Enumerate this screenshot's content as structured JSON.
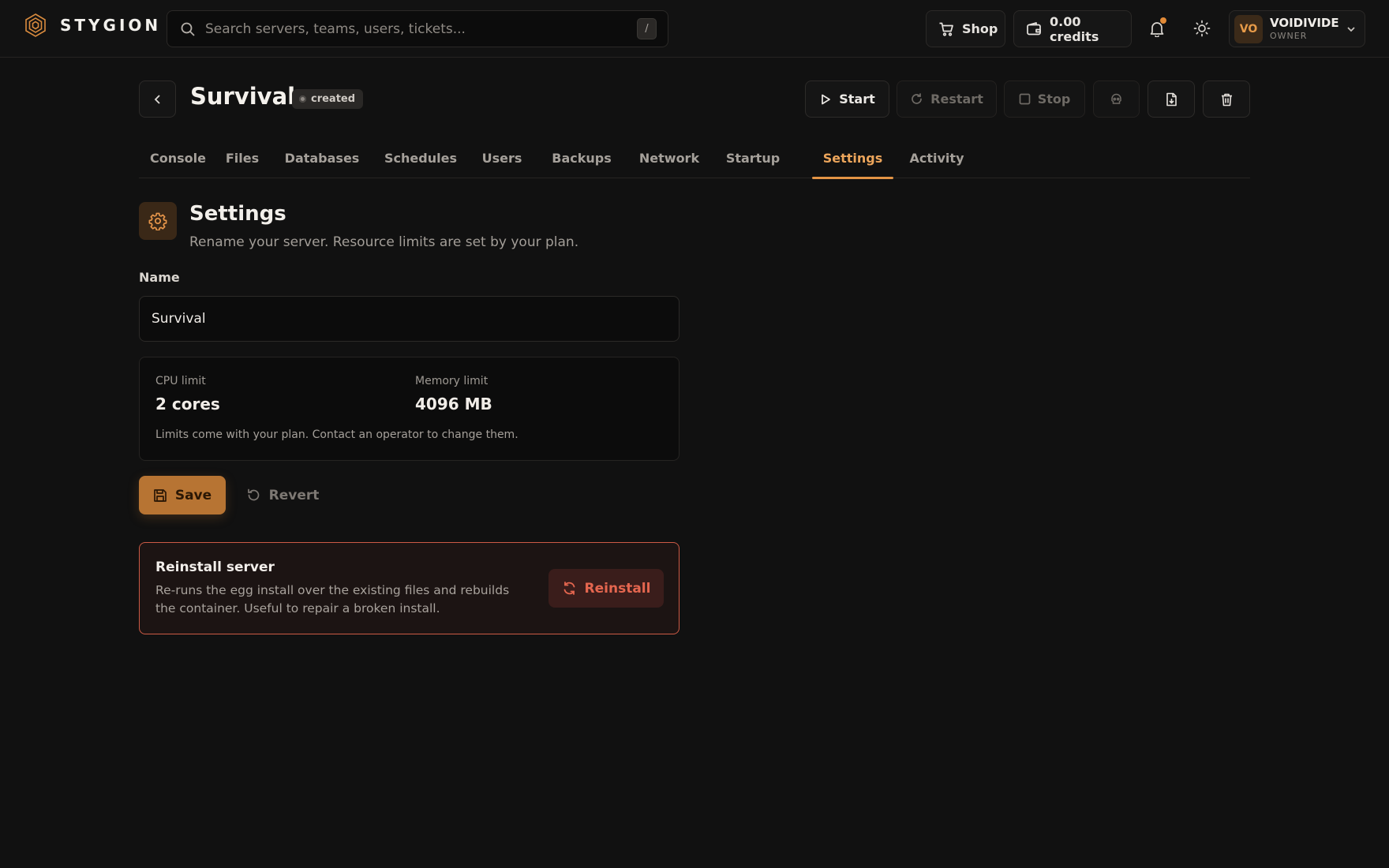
{
  "brand": {
    "name": "STYGION",
    "icon": "hexagon-logo-icon"
  },
  "search": {
    "placeholder": "Search servers, teams, users, tickets...",
    "value": "",
    "shortcut": "/"
  },
  "topbar": {
    "shop_label": "Shop",
    "credits_label": "0.00 credits",
    "has_notification": true,
    "user": {
      "initials": "VO",
      "name": "VOIDIVIDE",
      "role": "OWNER"
    }
  },
  "server": {
    "name": "Survival",
    "status": "created",
    "actions": {
      "start": "Start",
      "restart": "Restart",
      "stop": "Stop"
    }
  },
  "tabs": [
    {
      "label": "Console"
    },
    {
      "label": "Files"
    },
    {
      "label": "Databases"
    },
    {
      "label": "Schedules"
    },
    {
      "label": "Users"
    },
    {
      "label": "Backups"
    },
    {
      "label": "Network"
    },
    {
      "label": "Startup"
    },
    {
      "label": "Settings",
      "active": true
    },
    {
      "label": "Activity"
    }
  ],
  "settings": {
    "title": "Settings",
    "subtitle": "Rename your server. Resource limits are set by your plan.",
    "name_label": "Name",
    "name_value": "Survival",
    "limits": {
      "cpu_label": "CPU limit",
      "cpu_value": "2 cores",
      "memory_label": "Memory limit",
      "memory_value": "4096 MB",
      "note": "Limits come with your plan. Contact an operator to change them."
    },
    "save_label": "Save",
    "revert_label": "Revert"
  },
  "reinstall": {
    "title": "Reinstall server",
    "description": "Re-runs the egg install over the existing files and rebuilds the container. Useful to repair a broken install.",
    "button_label": "Reinstall"
  },
  "colors": {
    "accent": "#e39445",
    "danger": "#e4664f",
    "background": "#111111"
  }
}
